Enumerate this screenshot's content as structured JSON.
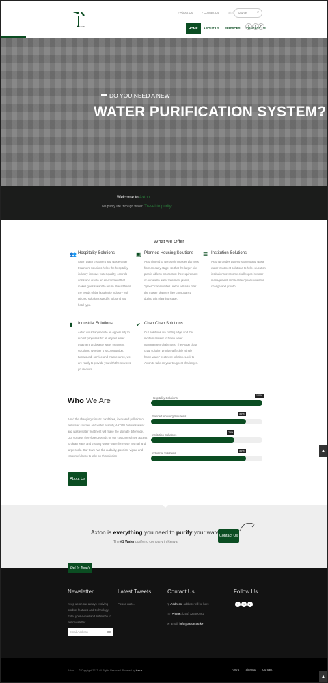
{
  "header": {
    "logo_text": "AXTON",
    "top_links": [
      "About Us",
      "Contact Us",
      "(254) 723600262"
    ],
    "search_placeholder": "search...",
    "nav": [
      {
        "label": "HOME",
        "active": true
      },
      {
        "label": "ABOUT US",
        "active": false
      },
      {
        "label": "SERVICES",
        "active": false
      },
      {
        "label": "CONTACT US",
        "active": false
      }
    ],
    "social": [
      "f",
      "t",
      "in"
    ]
  },
  "hero": {
    "subtitle": "DO YOU NEED A NEW",
    "title": "WATER PURIFICATION SYSTEM?"
  },
  "welcome": {
    "line1_prefix": "Welcome to",
    "line1_brand": "Axton",
    "line2_prefix": "we purify life through water.",
    "line2_highlight": "Travel to purify"
  },
  "offer": {
    "title": "What we Offer",
    "services": [
      {
        "title": "Hospitality Solutions",
        "icon": "users-icon",
        "text": "Axton water treatment and waste water treatment solutions helps the hospitality industry improve water quality, controls costs and create an environment that makes guests want to return. We address the needs of the hospitality industry with tailored solutions specific to brand and hotel type."
      },
      {
        "title": "Planned Housing Solutions",
        "icon": "film-icon",
        "text": "Axton intend to works with master planners from an early stage, so that the larger site plan is able to incorporate the requirement of our waste water treatment plants, \"green\" communities. Axton will also offer the master planners free consultancy during this planning stage."
      },
      {
        "title": "Institution Solutions",
        "icon": "list-icon",
        "text": "Axton provides water treatment and waste water treatment solutions to help education institutions overcome challenges in water management and realize opportunities for change and growth."
      },
      {
        "title": "Industrial Solutions",
        "icon": "document-icon",
        "text": "Axton would appreciate an opportunity to submit proposals for all of your water treatment and waste water treatment solutions. Whether it is construction, turnaround, service and maintenance, we are ready to provide you with the services you require."
      },
      {
        "title": "Chap Chap Solutions",
        "icon": "check-icon",
        "text": "Our solutions are cutting edge and the modern answer to home water management challenges. The Axton chap chap solution provide a flexible 'single home water' treatment solution. Look to Axton to take on your toughest challenges."
      }
    ]
  },
  "who": {
    "title_bold": "Who",
    "title_rest": "We Are",
    "text": "Amid the changing climatic conditions, increased pollution of our water sources and water scarcity, AXTON believes water and waste water treatment will make the ultimate difference. Our success therefore depends on our customers have access to clean water and treating waste water for reuse in small and large scale. Our team has the audacity, passion, vigour and resourcefulness to take on this mission",
    "button": "About Us",
    "skills": [
      {
        "label": "Hospitality Solutions",
        "percent": 100
      },
      {
        "label": "Planned Housing Solutions",
        "percent": 85
      },
      {
        "label": "Institution Solutions",
        "percent": 75
      },
      {
        "label": "Industrial Solutions",
        "percent": 85
      }
    ]
  },
  "cta": {
    "l1_a": "Axton is",
    "l1_b": "everything",
    "l1_c": "you need to",
    "l1_d": "purify",
    "l1_e": "your water",
    "l2_a": "The",
    "l2_b": "#1 Water",
    "l2_c": "purifying company in Kenya",
    "button": "Contact Us"
  },
  "footer": {
    "get_in_touch": "Get In Touch",
    "newsletter_title": "Newsletter",
    "newsletter_text": "Keep up on our always evolving product features and technology. Enter your e-mail and subscribe to our newsletter.",
    "email_placeholder": "Email Address",
    "go": "GO",
    "tweets_title": "Latest Tweets",
    "tweets_text": "Please wait...",
    "contact_title": "Contact Us",
    "address_label": "Address:",
    "address_value": "address will be here",
    "phone_label": "Phone:",
    "phone_value": "(254) 723600262",
    "email_label": "Email:",
    "email_value": "info@axton.co.ke",
    "follow_title": "Follow Us",
    "follow_icons": [
      "f",
      "t",
      "in"
    ]
  },
  "bottom": {
    "brand": "Axton",
    "copyright": "© Copyright 2017. All Rights Reserved. Powered by",
    "powered_by": "Icaruz",
    "links": [
      "FAQ's",
      "Sitemap",
      "Contact"
    ]
  },
  "colors": {
    "accent": "#0b4d22",
    "dark": "#131313",
    "hero": "#7a7a7a"
  }
}
